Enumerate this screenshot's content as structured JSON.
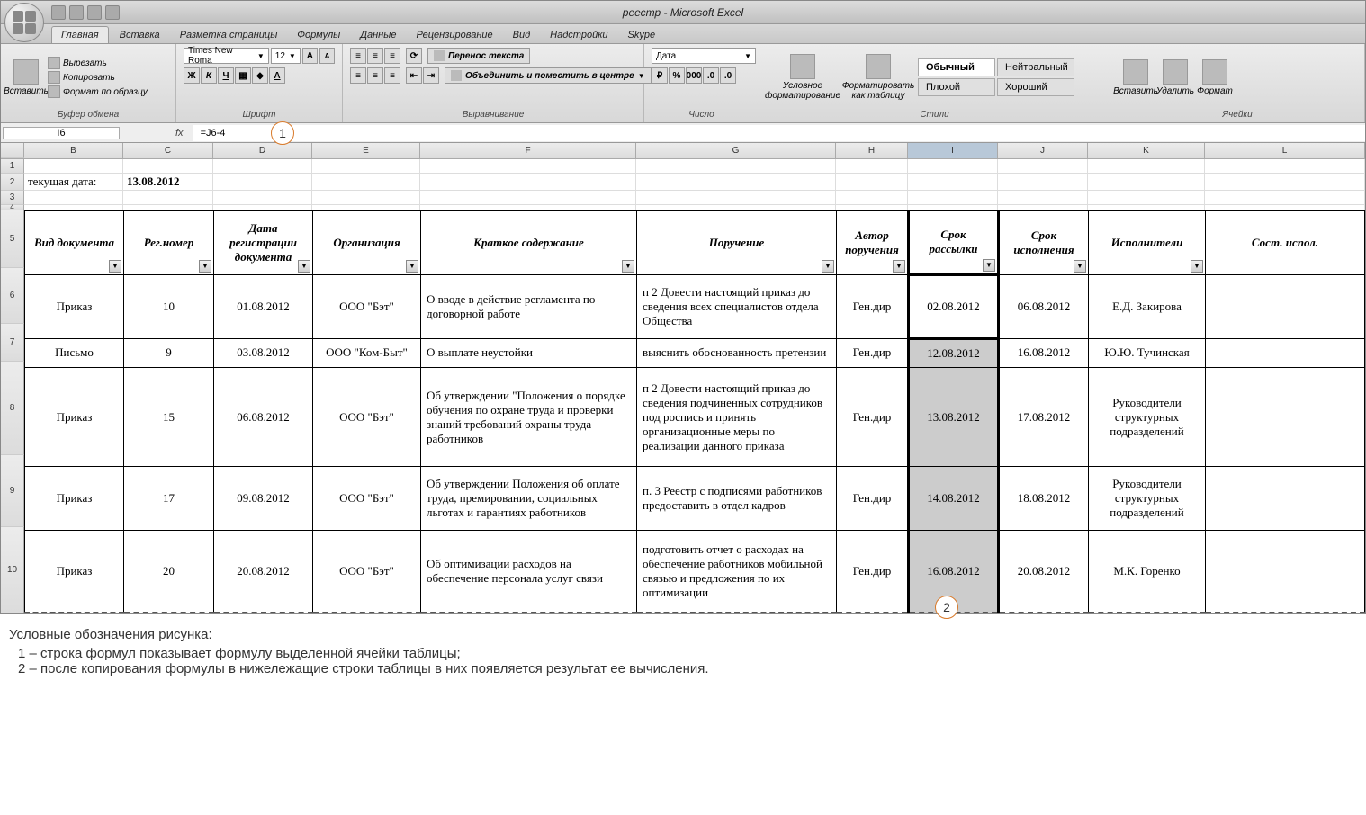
{
  "app": {
    "title": "реестр - Microsoft Excel"
  },
  "tabs": {
    "items": [
      "Главная",
      "Вставка",
      "Разметка страницы",
      "Формулы",
      "Данные",
      "Рецензирование",
      "Вид",
      "Надстройки",
      "Skype"
    ],
    "active": 0
  },
  "ribbon": {
    "clipboard": {
      "paste": "Вставить",
      "cut": "Вырезать",
      "copy": "Копировать",
      "format_painter": "Формат по образцу",
      "label": "Буфер обмена"
    },
    "font": {
      "name": "Times New Roma",
      "size": "12",
      "label": "Шрифт"
    },
    "alignment": {
      "wrap": "Перенос текста",
      "merge": "Объединить и поместить в центре",
      "label": "Выравнивание"
    },
    "number": {
      "format": "Дата",
      "label": "Число"
    },
    "styles": {
      "cond_fmt": "Условное форматирование",
      "fmt_table": "Форматировать как таблицу",
      "normal": "Обычный",
      "neutral": "Нейтральный",
      "bad": "Плохой",
      "good": "Хороший",
      "label": "Стили"
    },
    "cells": {
      "insert": "Вставить",
      "delete": "Удалить",
      "format": "Формат",
      "label": "Ячейки"
    }
  },
  "formula_bar": {
    "name_box": "I6",
    "fx": "fx",
    "formula": "=J6-4"
  },
  "columns": [
    "B",
    "C",
    "D",
    "E",
    "F",
    "G",
    "H",
    "I",
    "J",
    "K",
    "L"
  ],
  "col_widths": {
    "rownum": 26,
    "B": 110,
    "C": 100,
    "D": 110,
    "E": 120,
    "F": 240,
    "G": 222,
    "H": 80,
    "I": 100,
    "J": 100,
    "K": 130,
    "L": 60
  },
  "pre": {
    "label_cell": "текущая дата:",
    "date_cell": "13.08.2012"
  },
  "headers": [
    "Вид документа",
    "Рег.номер",
    "Дата регистрации документа",
    "Организация",
    "Краткое содержание",
    "Поручение",
    "Автор поручения",
    "Срок рассылки",
    "Срок исполнения",
    "Исполнители",
    "Сост. испол."
  ],
  "rows": [
    {
      "n": 6,
      "vid": "Приказ",
      "reg": "10",
      "dreg": "01.08.2012",
      "org": "ООО \"Бэт\"",
      "kr": "О вводе в действие регламента по договорной работе",
      "por": "п 2 Довести настоящий приказ до сведения всех специалистов отдела Общества",
      "avt": "Ген.дир",
      "sr": "02.08.2012",
      "si": "06.08.2012",
      "isp": "Е.Д. Закирова",
      "shade": false
    },
    {
      "n": 7,
      "vid": "Письмо",
      "reg": "9",
      "dreg": "03.08.2012",
      "org": "ООО \"Ком-Быт\"",
      "kr": "О выплате неустойки",
      "por": "выяснить обоснованность претензии",
      "avt": "Ген.дир",
      "sr": "12.08.2012",
      "si": "16.08.2012",
      "isp": "Ю.Ю. Тучинская",
      "shade": true
    },
    {
      "n": 8,
      "vid": "Приказ",
      "reg": "15",
      "dreg": "06.08.2012",
      "org": "ООО \"Бэт\"",
      "kr": "Об утверждении \"Положения о порядке обучения по охране труда и проверки знаний требований охраны труда работников",
      "por": "п 2 Довести настоящий приказ до сведения подчиненных сотрудников под роспись и принять организационные меры по реализации данного приказа",
      "avt": "Ген.дир",
      "sr": "13.08.2012",
      "si": "17.08.2012",
      "isp": "Руководители структурных подразделений",
      "shade": true
    },
    {
      "n": 9,
      "vid": "Приказ",
      "reg": "17",
      "dreg": "09.08.2012",
      "org": "ООО \"Бэт\"",
      "kr": "Об утверждении Положения об оплате труда, премировании, социальных льготах и гарантиях работников",
      "por": "п. 3 Реестр с подписями работников предоставить в отдел кадров",
      "avt": "Ген.дир",
      "sr": "14.08.2012",
      "si": "18.08.2012",
      "isp": "Руководители структурных подразделений",
      "shade": true
    },
    {
      "n": 10,
      "vid": "Приказ",
      "reg": "20",
      "dreg": "20.08.2012",
      "org": "ООО \"Бэт\"",
      "kr": "Об оптимизации расходов на обеспечение персонала услуг связи",
      "por": "подготовить отчет о расходах на обеспечение работников мобильной связью и предложения по их оптимизации",
      "avt": "Ген.дир",
      "sr": "16.08.2012",
      "si": "20.08.2012",
      "isp": "М.К. Горенко",
      "shade": true
    }
  ],
  "callouts": {
    "c1": "1",
    "c2": "2"
  },
  "legend": {
    "title": "Условные обозначения рисунка:",
    "l1": "1 –  строка формул показывает формулу выделенной ячейки таблицы;",
    "l2": "2 –  после копирования формулы в нижележащие строки таблицы в них появляется результат ее вычисления."
  }
}
